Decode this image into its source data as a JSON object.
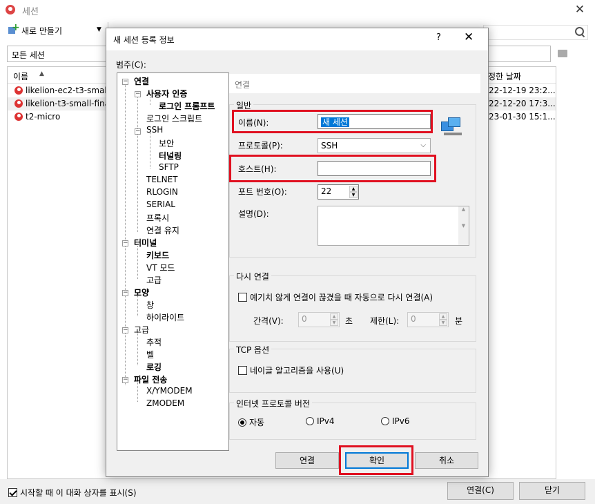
{
  "window": {
    "title": "세션",
    "close_icon": "✕"
  },
  "toolbar": {
    "new_label": "새로 만들기"
  },
  "filter": {
    "value": "모든 세션"
  },
  "list": {
    "header_name": "이름",
    "header_date": "정한 날짜",
    "rows": [
      {
        "name": "likelion-ec2-t3-small",
        "date": "22-12-19 23:2..."
      },
      {
        "name": "likelion-t3-small-finall",
        "date": "22-12-20 17:3..."
      },
      {
        "name": "t2-micro",
        "date": "23-01-30 15:1..."
      }
    ]
  },
  "footer": {
    "startup_label": "시작할 때 이 대화 상자를 표시(S)",
    "connect_label": "연결(C)",
    "close_label": "닫기"
  },
  "dialog": {
    "title": "새 세션 등록 정보",
    "help": "?",
    "close": "✕",
    "category_label": "범주(C):",
    "tree": [
      {
        "label": "연결",
        "bold": true
      },
      {
        "label": "사용자 인증",
        "bold": true
      },
      {
        "label": "로그인 프롬프트",
        "bold": true
      },
      {
        "label": "로그인 스크립트",
        "bold": false
      },
      {
        "label": "SSH",
        "bold": false
      },
      {
        "label": "보안",
        "bold": false
      },
      {
        "label": "터널링",
        "bold": true
      },
      {
        "label": "SFTP",
        "bold": false
      },
      {
        "label": "TELNET",
        "bold": false
      },
      {
        "label": "RLOGIN",
        "bold": false
      },
      {
        "label": "SERIAL",
        "bold": false
      },
      {
        "label": "프록시",
        "bold": false
      },
      {
        "label": "연결 유지",
        "bold": false
      },
      {
        "label": "터미널",
        "bold": true
      },
      {
        "label": "키보드",
        "bold": true
      },
      {
        "label": "VT 모드",
        "bold": false
      },
      {
        "label": "고급",
        "bold": false
      },
      {
        "label": "모양",
        "bold": true
      },
      {
        "label": "창",
        "bold": false
      },
      {
        "label": "하이라이트",
        "bold": false
      },
      {
        "label": "고급",
        "bold": false
      },
      {
        "label": "추적",
        "bold": false
      },
      {
        "label": "벨",
        "bold": false
      },
      {
        "label": "로깅",
        "bold": true
      },
      {
        "label": "파일 전송",
        "bold": true
      },
      {
        "label": "X/YMODEM",
        "bold": false
      },
      {
        "label": "ZMODEM",
        "bold": false
      }
    ],
    "section_header": "연결",
    "general": {
      "group_title": "일반",
      "name_label": "이름(N):",
      "name_value": "새 세션",
      "protocol_label": "프로토콜(P):",
      "protocol_value": "SSH",
      "host_label": "호스트(H):",
      "host_value": "",
      "port_label": "포트 번호(O):",
      "port_value": "22",
      "desc_label": "설명(D):"
    },
    "reconnect": {
      "group_title": "다시 연결",
      "checkbox_label": "예기치 않게 연결이 끊겼을 때 자동으로 다시 연결(A)",
      "interval_label": "간격(V):",
      "interval_value": "0",
      "interval_unit": "초",
      "limit_label": "제한(L):",
      "limit_value": "0",
      "limit_unit": "분"
    },
    "tcp": {
      "group_title": "TCP 옵션",
      "nagle_label": "네이글 알고리즘을 사용(U)"
    },
    "ip": {
      "group_title": "인터넷 프로토콜 버전",
      "auto": "자동",
      "ipv4": "IPv4",
      "ipv6": "IPv6"
    },
    "buttons": {
      "connect": "연결",
      "ok": "확인",
      "cancel": "취소"
    }
  },
  "colors": {
    "highlight": "#e01020",
    "selection": "#0078d7"
  }
}
